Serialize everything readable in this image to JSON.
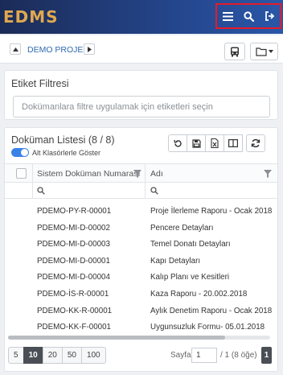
{
  "app": {
    "logo": "EDMS"
  },
  "header_actions": [
    {
      "name": "menu-icon"
    },
    {
      "name": "search-icon"
    },
    {
      "name": "logout-icon"
    }
  ],
  "breadcrumb": {
    "project": "DEMO PROJE"
  },
  "tag_filter": {
    "title": "Etiket Filtresi",
    "placeholder": "Dokümanlara filtre uygulamak için etiketleri seçin"
  },
  "doc_list": {
    "title": "Doküman Listesi (8 / 8)",
    "toggle_label": "Alt Klasörlerle Göster",
    "toggle_on": true,
    "columns": [
      "Sistem Doküman Numarası",
      "Adı"
    ],
    "rows": [
      {
        "number": "PDEMO-PY-R-00001",
        "name": "Proje İlerleme Raporu - Ocak 2018"
      },
      {
        "number": "PDEMO-MI-D-00002",
        "name": "Pencere Detayları"
      },
      {
        "number": "PDEMO-MI-D-00003",
        "name": "Temel Donatı Detayları"
      },
      {
        "number": "PDEMO-MI-D-00001",
        "name": "Kapı Detayları"
      },
      {
        "number": "PDEMO-MI-D-00004",
        "name": "Kalıp Planı ve Kesitleri"
      },
      {
        "number": "PDEMO-İS-R-00001",
        "name": "Kaza Raporu - 20.002.2018"
      },
      {
        "number": "PDEMO-KK-R-00001",
        "name": "Aylık Denetim Raporu - Ocak 2018"
      },
      {
        "number": "PDEMO-KK-F-00001",
        "name": "Uygunsuzluk Formu- 05.01.2018"
      }
    ]
  },
  "pager": {
    "sizes": [
      "5",
      "10",
      "20",
      "50",
      "100"
    ],
    "active_size": "10",
    "page_label": "Sayfa",
    "page_value": "1",
    "page_info": "/ 1 (8 öğe)",
    "current_page": "1"
  }
}
